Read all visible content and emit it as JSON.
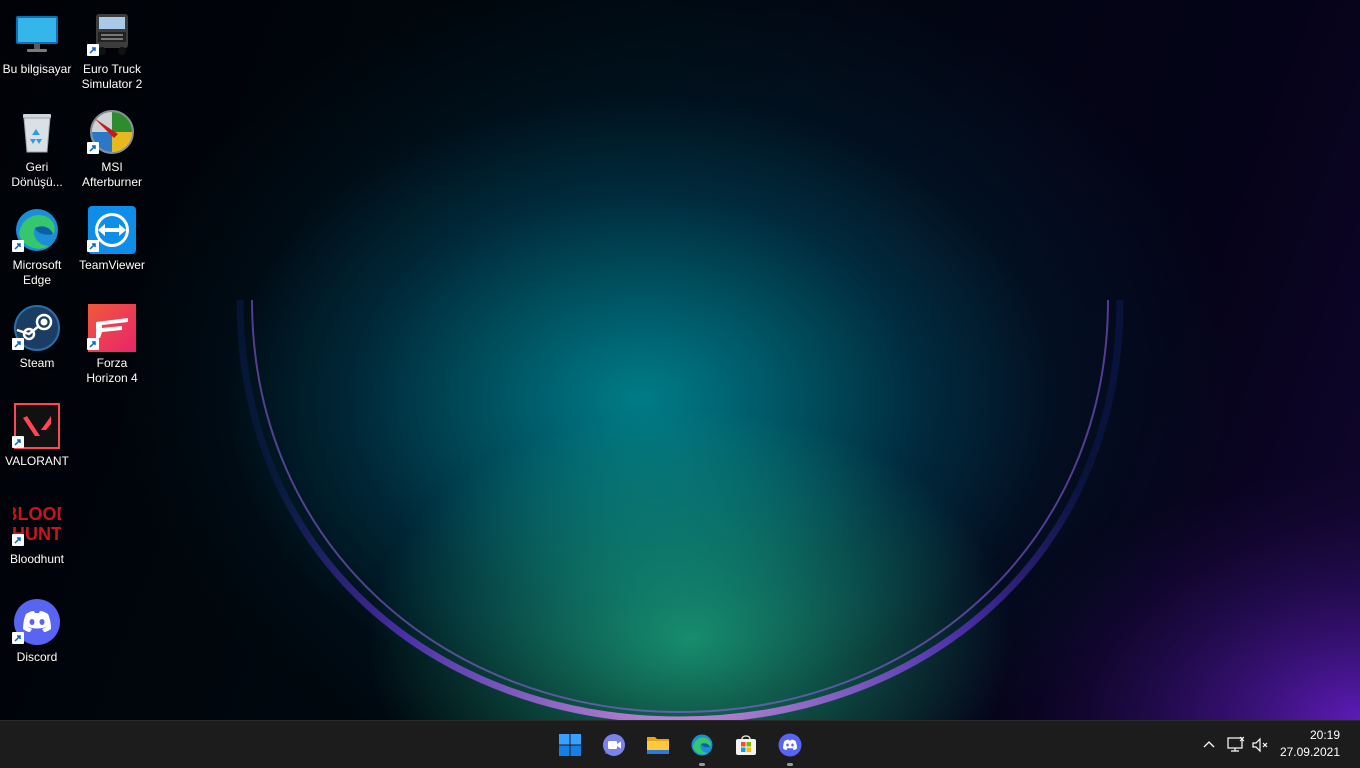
{
  "desktop": {
    "icons": [
      {
        "label": "Bu bilgisayar",
        "icon": "monitor-icon"
      },
      {
        "label": "Euro Truck Simulator 2",
        "icon": "truck-icon"
      },
      {
        "label": "Geri Dönüşü...",
        "icon": "recycle-bin-icon"
      },
      {
        "label": "MSI Afterburner",
        "icon": "afterburner-icon"
      },
      {
        "label": "Microsoft Edge",
        "icon": "edge-icon"
      },
      {
        "label": "TeamViewer",
        "icon": "teamviewer-icon"
      },
      {
        "label": "Steam",
        "icon": "steam-icon"
      },
      {
        "label": "Forza Horizon 4",
        "icon": "forza-icon"
      },
      {
        "label": "VALORANT",
        "icon": "valorant-icon"
      },
      {
        "label": "Bloodhunt",
        "icon": "bloodhunt-icon"
      },
      {
        "label": "Discord",
        "icon": "discord-icon"
      }
    ],
    "bloodhunt_logo_text": "BLOOD HUNT"
  },
  "taskbar": {
    "apps": [
      {
        "name": "start-button",
        "icon": "windows-logo-icon"
      },
      {
        "name": "teams-chat",
        "icon": "video-chat-icon"
      },
      {
        "name": "file-explorer",
        "icon": "folder-icon"
      },
      {
        "name": "microsoft-edge",
        "icon": "edge-icon",
        "running": true
      },
      {
        "name": "microsoft-store",
        "icon": "store-icon"
      },
      {
        "name": "discord",
        "icon": "discord-icon",
        "running": true
      }
    ],
    "tray": {
      "icons": [
        "chevron-up-icon",
        "network-icon",
        "volume-muted-icon"
      ]
    },
    "clock": {
      "time": "20:19",
      "date": "27.09.2021"
    }
  },
  "colors": {
    "taskbar_bg": "#1c1c1c",
    "accent": "#0078d4",
    "discord": "#5865f2"
  }
}
